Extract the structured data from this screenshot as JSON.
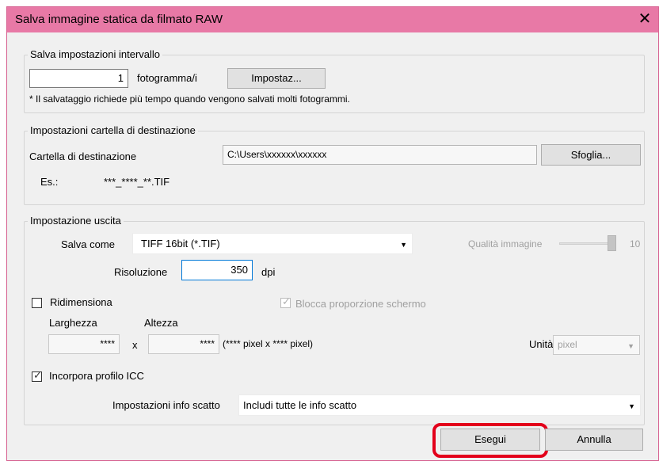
{
  "window": {
    "title": "Salva immagine statica da filmato RAW",
    "close_glyph": "✕"
  },
  "interval": {
    "legend": "Salva impostazioni intervallo",
    "frames_value": "1",
    "frames_unit": "fotogramma/i",
    "settings_button": "Impostaz...",
    "note": "* Il salvataggio richiede più tempo quando vengono salvati molti fotogrammi."
  },
  "destination": {
    "legend": "Impostazioni cartella di destinazione",
    "folder_label": "Cartella di destinazione",
    "folder_path": "C:\\Users\\xxxxxx\\xxxxxx",
    "browse_button": "Sfoglia...",
    "example_label": "Es.:",
    "example_value": "***_****_**.TIF"
  },
  "output": {
    "legend": "Impostazione uscita",
    "save_as_label": "Salva come",
    "save_as_value": "TIFF 16bit (*.TIF)",
    "quality_label": "Qualità immagine",
    "quality_value": "10",
    "resolution_label": "Risoluzione",
    "resolution_value": "350",
    "resolution_unit": "dpi",
    "resize_label": "Ridimensiona",
    "resize_checked": false,
    "lock_ratio_label": "Blocca proporzione schermo",
    "lock_ratio_checked": true,
    "width_label": "Larghezza",
    "height_label": "Altezza",
    "width_value": "****",
    "times": "x",
    "height_value": "****",
    "pixel_summary": "(**** pixel x **** pixel)",
    "unit_label": "Unità",
    "unit_value": "pixel",
    "icc_label": "Incorpora profilo ICC",
    "icc_checked": true,
    "shot_info_label": "Impostazioni info scatto",
    "shot_info_value": "Includi tutte le info scatto"
  },
  "footer": {
    "run_button": "Esegui",
    "cancel_button": "Annulla"
  },
  "colors": {
    "titlebar": "#e879a6",
    "highlight": "#e3001b",
    "focus_border": "#0078d7"
  },
  "icons": [
    "close-icon",
    "dropdown-arrow-icon",
    "checkmark-icon",
    "slider-thumb"
  ]
}
